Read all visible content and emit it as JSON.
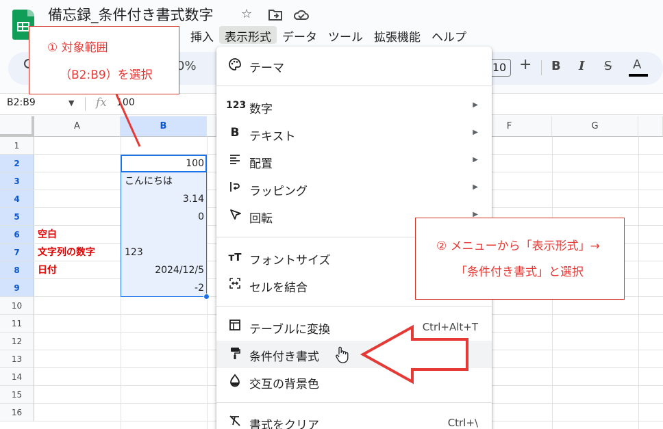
{
  "app": {
    "title": "備忘録_条件付き書式数字",
    "icons": [
      "star-icon",
      "move-to-folder-icon",
      "cloud-status-icon"
    ]
  },
  "menubar": {
    "items": [
      "挿入",
      "表示形式",
      "データ",
      "ツール",
      "拡張機能",
      "ヘルプ"
    ],
    "active": "表示形式"
  },
  "toolbar": {
    "zoom_partial": "0%",
    "font_size": "10",
    "plus": "+",
    "bold": "B",
    "italic": "I",
    "strike": "S",
    "text_color": "A"
  },
  "formula_bar": {
    "name_box": "B2:B9",
    "fx": "fx",
    "value": "100"
  },
  "grid": {
    "columns": [
      "A",
      "B",
      "F",
      "G"
    ],
    "rows": [
      "1",
      "2",
      "3",
      "4",
      "5",
      "6",
      "7",
      "8",
      "9",
      "10",
      "11",
      "12",
      "13",
      "14",
      "15",
      "16"
    ],
    "cells": {
      "B2": "100",
      "B3": "こんにちは",
      "B4": "3.14",
      "B5": "0",
      "B7": "123",
      "B8": "2024/12/5",
      "B9": "-2",
      "A6": "空白",
      "A7": "文字列の数字",
      "A8": "日付"
    }
  },
  "format_menu": {
    "items": [
      {
        "icon": "palette-icon",
        "label": "テーマ"
      },
      {
        "icon": "number-format-icon",
        "glyph": "123",
        "label": "数字",
        "submenu": true
      },
      {
        "icon": "bold-text-icon",
        "glyph": "B",
        "label": "テキスト",
        "submenu": true
      },
      {
        "icon": "align-icon",
        "label": "配置",
        "submenu": true
      },
      {
        "icon": "wrap-icon",
        "label": "ラッピング",
        "submenu": true
      },
      {
        "icon": "rotate-icon",
        "label": "回転",
        "submenu": true
      },
      {
        "icon": "font-size-icon",
        "glyph": "тT",
        "label": "フォントサイズ"
      },
      {
        "icon": "merge-icon",
        "label": "セルを結合"
      },
      {
        "icon": "table-icon",
        "label": "テーブルに変換",
        "shortcut": "Ctrl+Alt+T"
      },
      {
        "icon": "paint-roller-icon",
        "label": "条件付き書式"
      },
      {
        "icon": "alternating-colors-icon",
        "label": "交互の背景色"
      },
      {
        "icon": "clear-format-icon",
        "label": "書式をクリア",
        "shortcut": "Ctrl+\\"
      }
    ]
  },
  "annotations": {
    "step1_line1": "① 対象範囲",
    "step1_line2": "（B2:B9）を選択",
    "step2_line1": "② メニューから「表示形式」→",
    "step2_line2": "「条件付き書式」と選択",
    "accent_color": "#e53935"
  }
}
